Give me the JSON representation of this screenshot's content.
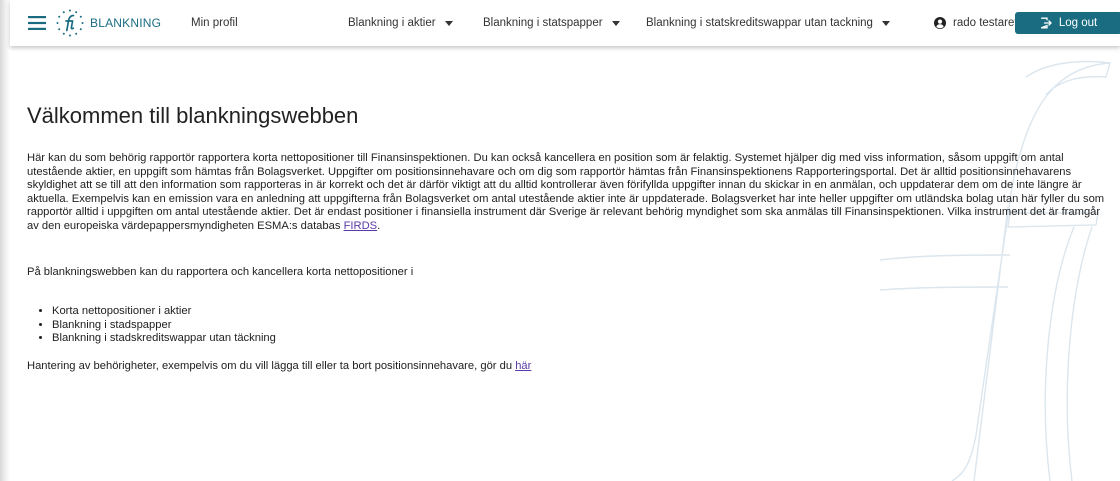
{
  "nav": {
    "brand_text": "BLANKNING",
    "profile_label": "Min profil",
    "menus": [
      {
        "label": "Blankning i aktier"
      },
      {
        "label": "Blankning i statspapper"
      },
      {
        "label": "Blankning i statskreditswappar utan tackning"
      }
    ],
    "user_name": "rado testaretre",
    "logout_label": "Log out",
    "accent_color": "#1a6c81",
    "icons": {
      "menu": "hamburger-menu-icon",
      "logo": "fi-logo",
      "user": "user-circle-icon",
      "logout": "sign-out-icon",
      "dropdown": "caret-down-icon"
    }
  },
  "main": {
    "title": "Välkommen till blankningswebben",
    "intro_text": "Här kan du som behörig rapportör rapportera korta nettopositioner till Finansinspektionen. Du kan också kancellera en position som är felaktig. Systemet hjälper dig med viss information, såsom uppgift om antal utestående aktier, en uppgift som hämtas från Bolagsverket. Uppgifter om positionsinnehavare och om dig som rapportör hämtas från Finansinspektionens Rapporteringsportal. Det är alltid positionsinnehavarens skyldighet att se till att den information som rapporteras in är korrekt och det är därför viktigt att du alltid kontrollerar även förifyllda uppgifter innan du skickar in en anmälan, och uppdaterar dem om de inte längre är aktuella. Exempelvis kan en emission vara en anledning att uppgifterna från Bolagsverket om antal utestående aktier inte är uppdaterade. Bolagsverket har inte heller uppgifter om utländska bolag utan här fyller du som rapportör alltid i uppgiften om antal utestående aktier. Det är endast positioner i finansiella instrument där Sverige är relevant behörig myndighet som ska anmälas till Finansinspektionen. Vilka instrument det är framgår av den europeiska värdepappersmyndigheten ESMA:s databas ",
    "firds_link": "FIRDS",
    "intro_end": ".",
    "sub_intro": "På blankningswebben kan du rapportera och kancellera korta nettopositioner i",
    "list": [
      {
        "text": "Korta nettopositioner i aktier"
      },
      {
        "text": "Blankning i stadspapper"
      },
      {
        "text": "Blankning i stadskreditswappar utan täckning"
      }
    ],
    "footer_text": "Hantering av behörigheter, exempelvis om du vill lägga till eller ta bort positionsinnehavare, gör du ",
    "footer_link": "här",
    "link_color": "#5a3aa8"
  }
}
